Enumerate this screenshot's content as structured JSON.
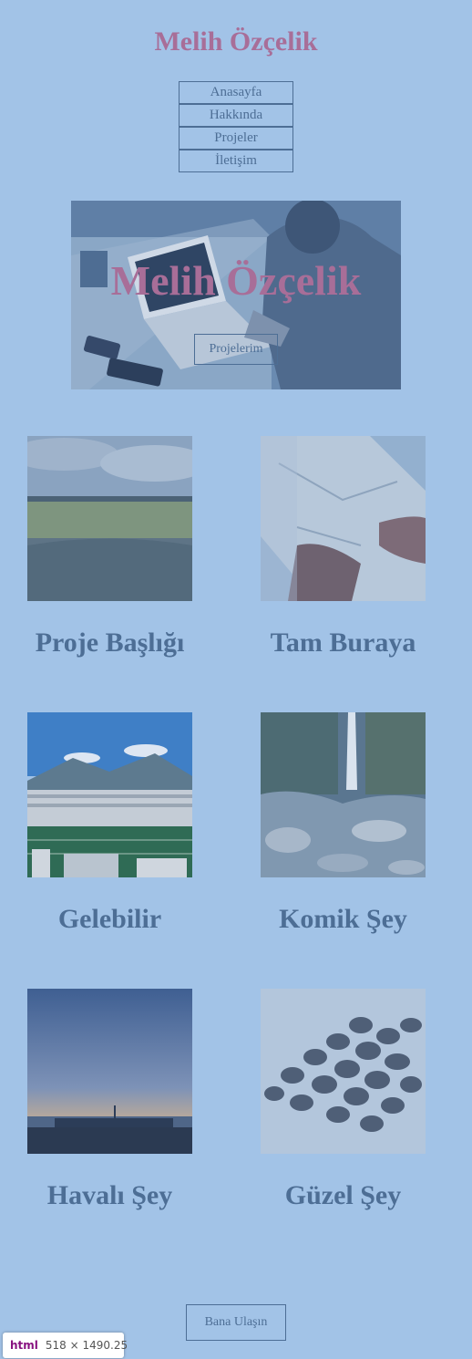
{
  "header": {
    "title": "Melih Özçelik"
  },
  "nav": {
    "items": [
      {
        "label": "Anasayfa"
      },
      {
        "label": "Hakkında"
      },
      {
        "label": "Projeler"
      },
      {
        "label": "İletişim"
      }
    ]
  },
  "hero": {
    "title": "Melih Özçelik",
    "button_label": "Projelerim"
  },
  "projects": [
    {
      "caption": "Proje Başlığı",
      "image": "wheat-field-photo"
    },
    {
      "caption": "Tam Buraya",
      "image": "map-in-hands-photo"
    },
    {
      "caption": "Gelebilir",
      "image": "stadium-photo"
    },
    {
      "caption": "Komik Şey",
      "image": "waterfall-photo"
    },
    {
      "caption": "Havalı Şey",
      "image": "pier-sunset-photo"
    },
    {
      "caption": "Güzel Şey",
      "image": "coffee-beans-photo"
    }
  ],
  "footer": {
    "contact_label": "Bana Ulaşın"
  },
  "devtools": {
    "tag": "html",
    "size": "518 × 1490.25"
  },
  "colors": {
    "background": "#a2c3e7",
    "title": "#a86e98",
    "text": "#4d6e95"
  }
}
